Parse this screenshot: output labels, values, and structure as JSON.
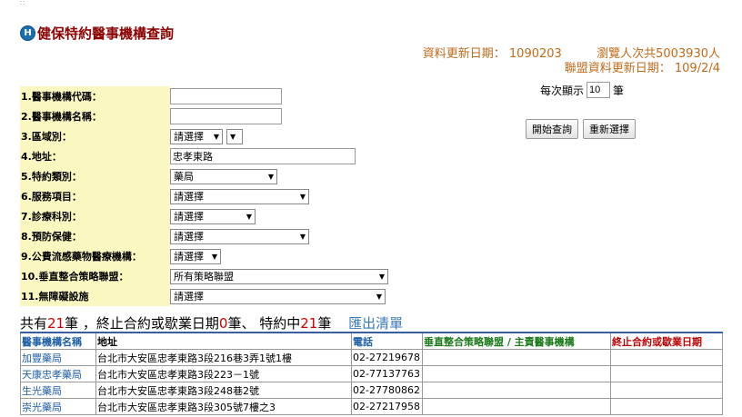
{
  "title": "健保特約醫事機構查詢",
  "logo_letter": "H",
  "update": {
    "data_date_label": "資料更新日期：",
    "data_date": "1090203",
    "visitors": "瀏覽人次共5003930人",
    "alliance_label": "聯盟資料更新日期：",
    "alliance_date": "109/2/4"
  },
  "form": [
    {
      "label": "1.醫事機構代碼：",
      "type": "text",
      "value": ""
    },
    {
      "label": "2.醫事機構名稱：",
      "type": "text",
      "value": ""
    },
    {
      "label": "3.區域別：",
      "type": "dual-select",
      "value": "請選擇"
    },
    {
      "label": "4.地址：",
      "type": "text",
      "value": "忠孝東路"
    },
    {
      "label": "5.特約類別：",
      "type": "select",
      "value": "藥局"
    },
    {
      "label": "6.服務項目：",
      "type": "select",
      "value": "請選擇"
    },
    {
      "label": "7.診療科別：",
      "type": "select",
      "value": "請選擇"
    },
    {
      "label": "8.預防保健：",
      "type": "select",
      "value": "請選擇"
    },
    {
      "label": "9.公費流感藥物醫療機構：",
      "type": "select",
      "value": "請選擇"
    },
    {
      "label": "10.垂直整合策略聯盟：",
      "type": "select",
      "value": "所有策略聯盟"
    },
    {
      "label": "11.無障礙設施",
      "type": "select",
      "value": "請選擇"
    }
  ],
  "per_page": {
    "label": "每次顯示",
    "value": "10",
    "unit": "筆"
  },
  "buttons": {
    "search": "開始查詢",
    "reset": "重新選擇"
  },
  "summary": {
    "p1": "共有",
    "total": "21",
    "p2": "筆 ，終止合約或歇業日期",
    "terminated": "0",
    "p3": "筆、 特約中",
    "active": "21",
    "p4": "筆",
    "export": "匯出清單"
  },
  "table": {
    "headers": [
      "醫事機構名稱",
      "地址",
      "電話",
      "垂直整合策略聯盟 / 主責醫事機構",
      "終止合約或歇業日期"
    ],
    "rows": [
      [
        "加豐藥局",
        "台北市大安區忠孝東路3段216巷3弄1號1樓",
        "02-27219678",
        "",
        ""
      ],
      [
        "天康忠孝藥局",
        "台北市大安區忠孝東路3段223－1號",
        "02-77137763",
        "",
        ""
      ],
      [
        "生光藥局",
        "台北市大安區忠孝東路3段248巷2號",
        "02-27780862",
        "",
        ""
      ],
      [
        "崇光藥局",
        "台北市大安區忠孝東路3段305號7樓之3",
        "02-27217958",
        "",
        ""
      ]
    ]
  }
}
